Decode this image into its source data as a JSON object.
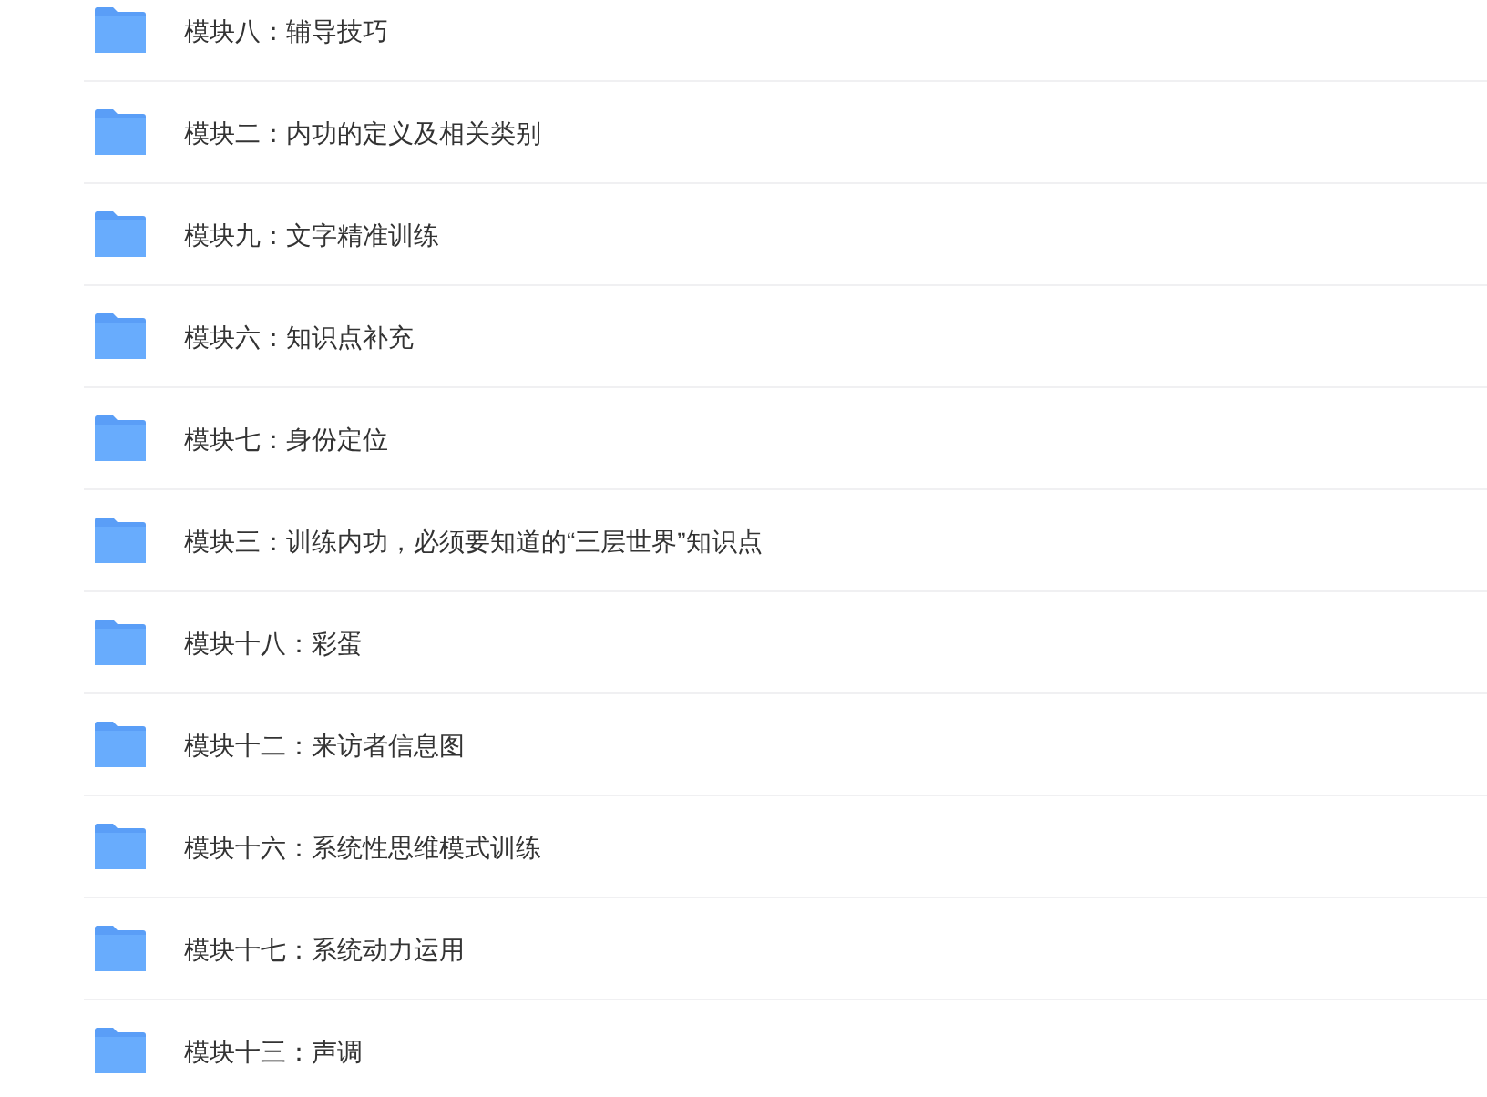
{
  "folders": [
    {
      "name": "模块八：辅导技巧"
    },
    {
      "name": "模块二：内功的定义及相关类别"
    },
    {
      "name": "模块九：文字精准训练"
    },
    {
      "name": "模块六：知识点补充"
    },
    {
      "name": "模块七：身份定位"
    },
    {
      "name": "模块三：训练内功，必须要知道的“三层世界”知识点"
    },
    {
      "name": "模块十八：彩蛋"
    },
    {
      "name": "模块十二：来访者信息图"
    },
    {
      "name": "模块十六：系统性思维模式训练"
    },
    {
      "name": "模块十七：系统动力运用"
    },
    {
      "name": "模块十三：声调"
    }
  ]
}
